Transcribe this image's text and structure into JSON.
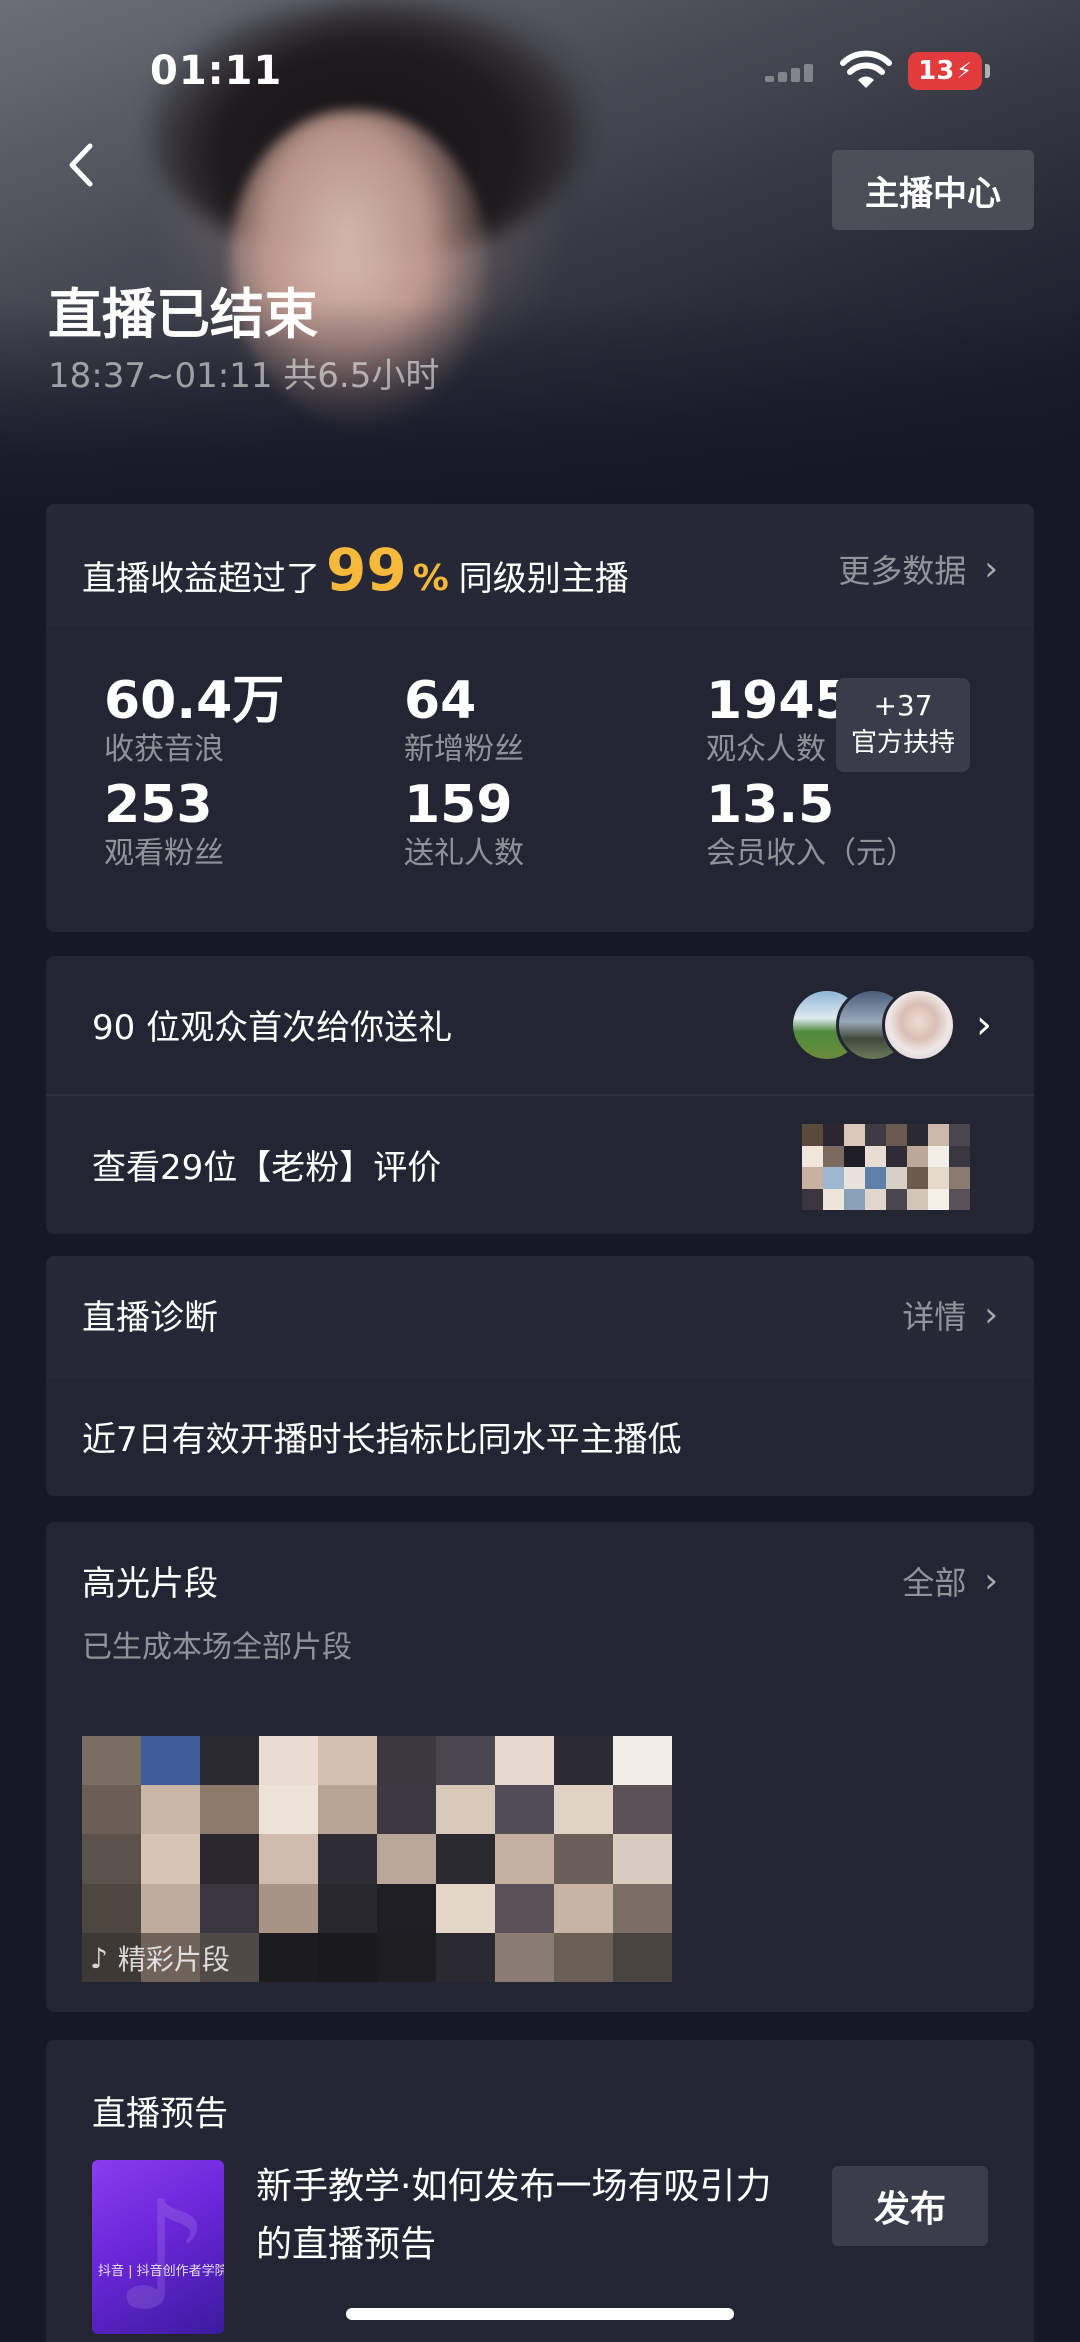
{
  "status_bar": {
    "time": "01:11",
    "battery": "13"
  },
  "header": {
    "anchor_center_label": "主播中心",
    "title": "直播已结束",
    "subtitle": "18:37~01:11 共6.5小时"
  },
  "summary": {
    "rank_prefix": "直播收益超过了",
    "rank_value": "99",
    "rank_unit": "%",
    "rank_suffix": "同级别主播",
    "more_label": "更多数据",
    "stats": [
      {
        "value": "60.4万",
        "label": "收获音浪"
      },
      {
        "value": "64",
        "label": "新增粉丝"
      },
      {
        "value": "1945",
        "label": "观众人数"
      },
      {
        "value": "253",
        "label": "观看粉丝"
      },
      {
        "value": "159",
        "label": "送礼人数"
      },
      {
        "value": "13.5",
        "label": "会员收入（元）"
      }
    ],
    "support_badge": {
      "value": "+37",
      "label": "官方扶持"
    }
  },
  "gifts_row": {
    "text": "90 位观众首次给你送礼"
  },
  "fans_row": {
    "text": "查看29位【老粉】评价"
  },
  "diagnosis": {
    "title": "直播诊断",
    "more_label": "详情",
    "text": "近7日有效开播时长指标比同水平主播低"
  },
  "highlights": {
    "title": "高光片段",
    "more_label": "全部",
    "subtitle": "已生成本场全部片段",
    "clip_label": "精彩片段"
  },
  "preview": {
    "title": "直播预告",
    "thumb_caption": "抖音 | 抖音创作者学院",
    "text": "新手教学·如何发布一场有吸引力的直播预告",
    "publish_label": "发布"
  },
  "colors": {
    "accent": "#f6b93b",
    "background": "#161826",
    "card": "#232533"
  }
}
